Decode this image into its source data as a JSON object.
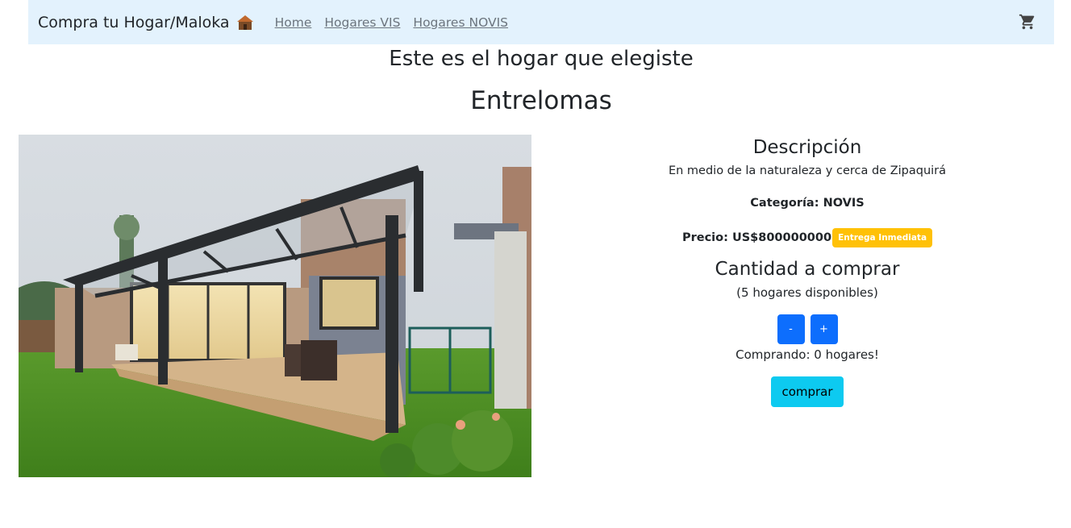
{
  "navbar": {
    "brand": "Compra tu Hogar/Maloka",
    "brand_icon": "house-emoji-icon",
    "links": [
      {
        "label": "Home"
      },
      {
        "label": "Hogares VIS"
      },
      {
        "label": "Hogares NOVIS"
      }
    ],
    "cart_icon": "shopping-cart-icon"
  },
  "page": {
    "heading": "Este es el hogar que elegiste",
    "home_name": "Entrelomas"
  },
  "details": {
    "description_title": "Descripción",
    "description": "En medio de la naturaleza y cerca de Zipaquirá",
    "category": "Categoría: NOVIS",
    "price": "Precio: US$800000000",
    "badge": "Entrega Inmediata",
    "quantity_title": "Cantidad a comprar",
    "available": "(5 hogares disponibles)",
    "decrement_label": "-",
    "increment_label": "+",
    "buying": "Comprando: 0 hogares!",
    "buy_label": "comprar"
  },
  "colors": {
    "navbar_bg": "#e3f2fd",
    "primary": "#0d6efd",
    "info": "#0dcaf0",
    "warning": "#ffc107"
  }
}
